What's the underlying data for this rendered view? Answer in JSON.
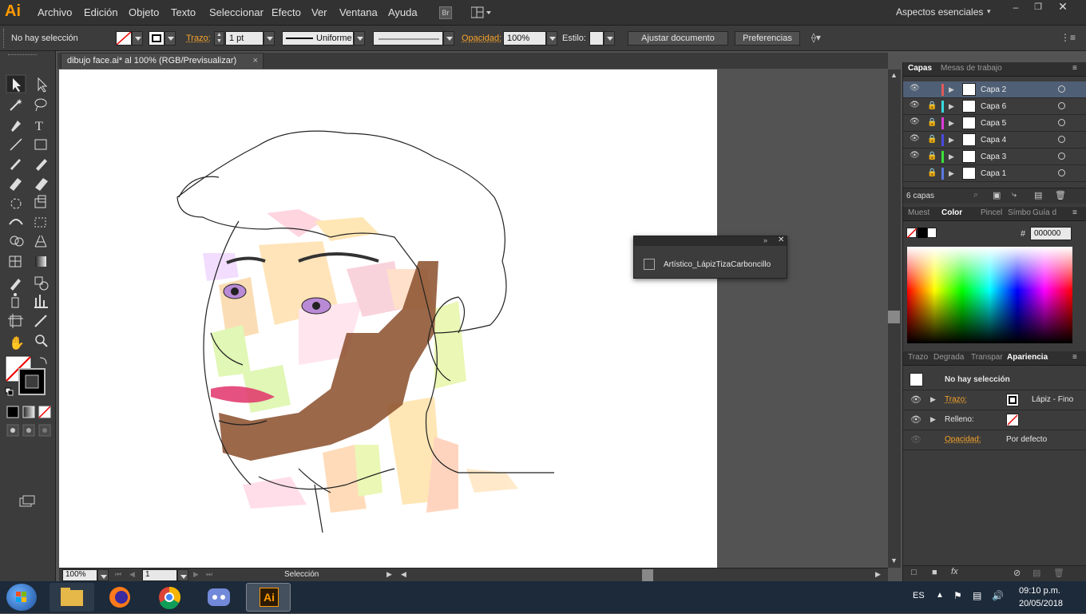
{
  "app": {
    "logo": "Ai",
    "workspace": "Aspectos esenciales",
    "bridge_label": "Br"
  },
  "menu": [
    "Archivo",
    "Edición",
    "Objeto",
    "Texto",
    "Seleccionar",
    "Efecto",
    "Ver",
    "Ventana",
    "Ayuda"
  ],
  "control": {
    "selection_status": "No hay selección",
    "stroke_label": "Trazo:",
    "stroke_weight": "1 pt",
    "profile": "Uniforme",
    "opacity_label": "Opacidad:",
    "opacity_value": "100%",
    "style_label": "Estilo:",
    "adjust_document": "Ajustar documento",
    "preferences": "Preferencias"
  },
  "document": {
    "tab_title": "dibujo face.ai* al 100% (RGB/Previsualizar)",
    "close": "×"
  },
  "status": {
    "zoom": "100%",
    "artboard": "1",
    "tool": "Selección"
  },
  "float_panel": {
    "brush": "Artístico_LápizTizaCarboncillo"
  },
  "layers_panel": {
    "tabs": [
      "Capas",
      "Mesas de trabajo"
    ],
    "layers": [
      {
        "name": "Capa 2",
        "color": "#e05a5a",
        "locked": false,
        "visible": true
      },
      {
        "name": "Capa 6",
        "color": "#3ad9e0",
        "locked": true,
        "visible": true
      },
      {
        "name": "Capa 5",
        "color": "#e03ad9",
        "locked": true,
        "visible": true
      },
      {
        "name": "Capa 4",
        "color": "#4a4ae0",
        "locked": true,
        "visible": true
      },
      {
        "name": "Capa 3",
        "color": "#3ae03a",
        "locked": true,
        "visible": true
      },
      {
        "name": "Capa 1",
        "color": "#5a78e0",
        "locked": true,
        "visible": false
      }
    ],
    "count": "6 capas"
  },
  "color_panel": {
    "tabs": [
      "Muest",
      "Color",
      "Pincel",
      "Símbo",
      "Guía d"
    ],
    "hash": "#",
    "hex": "000000"
  },
  "appearance_panel": {
    "tabs": [
      "Trazo",
      "Degrada",
      "Transpar",
      "Apariencia"
    ],
    "selection": "No hay selección",
    "stroke_label": "Trazo:",
    "stroke_value": "Lápiz - Fino",
    "fill_label": "Relleno:",
    "opacity_label": "Opacidad:",
    "opacity_value": "Por defecto"
  },
  "taskbar": {
    "language": "ES",
    "time": "09:10 p.m.",
    "date": "20/05/2018"
  }
}
